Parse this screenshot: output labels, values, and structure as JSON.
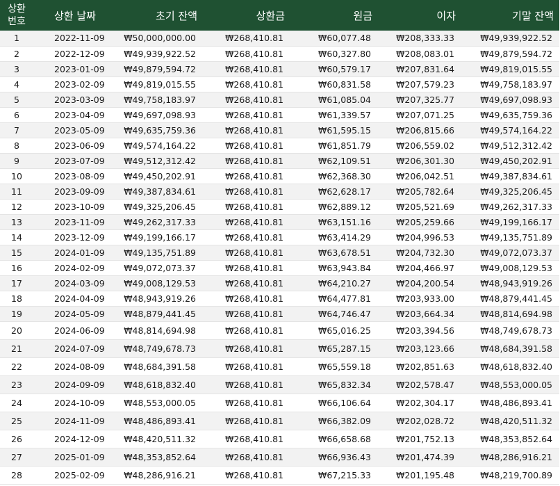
{
  "headers": {
    "num_line1": "상환",
    "num_line2": "번호",
    "date": "상환 날짜",
    "start_balance": "초기 잔액",
    "payment": "상환금",
    "principal": "원금",
    "interest": "이자",
    "end_balance": "기말 잔액"
  },
  "rows": [
    [
      "1",
      "2022-11-09",
      "₩50,000,000.00",
      "₩268,410.81",
      "₩60,077.48",
      "₩208,333.33",
      "₩49,939,922.52"
    ],
    [
      "2",
      "2022-12-09",
      "₩49,939,922.52",
      "₩268,410.81",
      "₩60,327.80",
      "₩208,083.01",
      "₩49,879,594.72"
    ],
    [
      "3",
      "2023-01-09",
      "₩49,879,594.72",
      "₩268,410.81",
      "₩60,579.17",
      "₩207,831.64",
      "₩49,819,015.55"
    ],
    [
      "4",
      "2023-02-09",
      "₩49,819,015.55",
      "₩268,410.81",
      "₩60,831.58",
      "₩207,579.23",
      "₩49,758,183.97"
    ],
    [
      "5",
      "2023-03-09",
      "₩49,758,183.97",
      "₩268,410.81",
      "₩61,085.04",
      "₩207,325.77",
      "₩49,697,098.93"
    ],
    [
      "6",
      "2023-04-09",
      "₩49,697,098.93",
      "₩268,410.81",
      "₩61,339.57",
      "₩207,071.25",
      "₩49,635,759.36"
    ],
    [
      "7",
      "2023-05-09",
      "₩49,635,759.36",
      "₩268,410.81",
      "₩61,595.15",
      "₩206,815.66",
      "₩49,574,164.22"
    ],
    [
      "8",
      "2023-06-09",
      "₩49,574,164.22",
      "₩268,410.81",
      "₩61,851.79",
      "₩206,559.02",
      "₩49,512,312.42"
    ],
    [
      "9",
      "2023-07-09",
      "₩49,512,312.42",
      "₩268,410.81",
      "₩62,109.51",
      "₩206,301.30",
      "₩49,450,202.91"
    ],
    [
      "10",
      "2023-08-09",
      "₩49,450,202.91",
      "₩268,410.81",
      "₩62,368.30",
      "₩206,042.51",
      "₩49,387,834.61"
    ],
    [
      "11",
      "2023-09-09",
      "₩49,387,834.61",
      "₩268,410.81",
      "₩62,628.17",
      "₩205,782.64",
      "₩49,325,206.45"
    ],
    [
      "12",
      "2023-10-09",
      "₩49,325,206.45",
      "₩268,410.81",
      "₩62,889.12",
      "₩205,521.69",
      "₩49,262,317.33"
    ],
    [
      "13",
      "2023-11-09",
      "₩49,262,317.33",
      "₩268,410.81",
      "₩63,151.16",
      "₩205,259.66",
      "₩49,199,166.17"
    ],
    [
      "14",
      "2023-12-09",
      "₩49,199,166.17",
      "₩268,410.81",
      "₩63,414.29",
      "₩204,996.53",
      "₩49,135,751.89"
    ],
    [
      "15",
      "2024-01-09",
      "₩49,135,751.89",
      "₩268,410.81",
      "₩63,678.51",
      "₩204,732.30",
      "₩49,072,073.37"
    ],
    [
      "16",
      "2024-02-09",
      "₩49,072,073.37",
      "₩268,410.81",
      "₩63,943.84",
      "₩204,466.97",
      "₩49,008,129.53"
    ],
    [
      "17",
      "2024-03-09",
      "₩49,008,129.53",
      "₩268,410.81",
      "₩64,210.27",
      "₩204,200.54",
      "₩48,943,919.26"
    ],
    [
      "18",
      "2024-04-09",
      "₩48,943,919.26",
      "₩268,410.81",
      "₩64,477.81",
      "₩203,933.00",
      "₩48,879,441.45"
    ],
    [
      "19",
      "2024-05-09",
      "₩48,879,441.45",
      "₩268,410.81",
      "₩64,746.47",
      "₩203,664.34",
      "₩48,814,694.98"
    ],
    [
      "20",
      "2024-06-09",
      "₩48,814,694.98",
      "₩268,410.81",
      "₩65,016.25",
      "₩203,394.56",
      "₩48,749,678.73"
    ],
    [
      "21",
      "2024-07-09",
      "₩48,749,678.73",
      "₩268,410.81",
      "₩65,287.15",
      "₩203,123.66",
      "₩48,684,391.58"
    ],
    [
      "22",
      "2024-08-09",
      "₩48,684,391.58",
      "₩268,410.81",
      "₩65,559.18",
      "₩202,851.63",
      "₩48,618,832.40"
    ],
    [
      "23",
      "2024-09-09",
      "₩48,618,832.40",
      "₩268,410.81",
      "₩65,832.34",
      "₩202,578.47",
      "₩48,553,000.05"
    ],
    [
      "24",
      "2024-10-09",
      "₩48,553,000.05",
      "₩268,410.81",
      "₩66,106.64",
      "₩202,304.17",
      "₩48,486,893.41"
    ],
    [
      "25",
      "2024-11-09",
      "₩48,486,893.41",
      "₩268,410.81",
      "₩66,382.09",
      "₩202,028.72",
      "₩48,420,511.32"
    ],
    [
      "26",
      "2024-12-09",
      "₩48,420,511.32",
      "₩268,410.81",
      "₩66,658.68",
      "₩201,752.13",
      "₩48,353,852.64"
    ],
    [
      "27",
      "2025-01-09",
      "₩48,353,852.64",
      "₩268,410.81",
      "₩66,936.43",
      "₩201,474.39",
      "₩48,286,916.21"
    ],
    [
      "28",
      "2025-02-09",
      "₩48,286,916.21",
      "₩268,410.81",
      "₩67,215.33",
      "₩201,195.48",
      "₩48,219,700.89"
    ]
  ]
}
